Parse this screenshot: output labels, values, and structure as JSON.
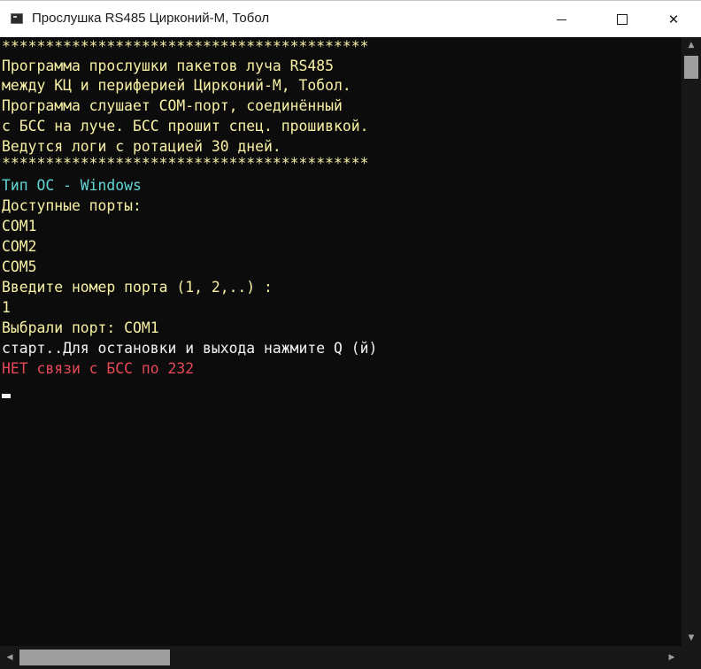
{
  "window": {
    "title": "Прослушка RS485 Цирконий-М, Тобол"
  },
  "titlebar": {
    "minimize_icon": "minimize-icon",
    "maximize_icon": "maximize-icon",
    "close_glyph": "✕"
  },
  "console": {
    "lines": [
      {
        "text": "******************************************",
        "color": "#f9f1a5"
      },
      {
        "text": "Программа прослушки пакетов луча RS485",
        "color": "#f9f1a5"
      },
      {
        "text": "между КЦ и периферией Цирконий-М, Тобол.",
        "color": "#f9f1a5"
      },
      {
        "text": "Программа слушает COM-порт, соединённый",
        "color": "#f9f1a5"
      },
      {
        "text": "с БСС на луче. БСС прошит спец. прошивкой.",
        "color": "#f9f1a5"
      },
      {
        "text": "Ведутся логи с ротацией 30 дней.",
        "color": "#f9f1a5"
      },
      {
        "text": "******************************************",
        "color": "#f9f1a5"
      },
      {
        "text": "Тип ОС - Windows",
        "color": "#61d6d6"
      },
      {
        "text": "Доступные порты:",
        "color": "#f9f1a5"
      },
      {
        "text": "COM1",
        "color": "#f9f1a5"
      },
      {
        "text": "COM2",
        "color": "#f9f1a5"
      },
      {
        "text": "COM5",
        "color": "#f9f1a5"
      },
      {
        "text": "Введите номер порта (1, 2,..) :",
        "color": "#f9f1a5"
      },
      {
        "text": "1",
        "color": "#f9f1a5"
      },
      {
        "text": "Выбрали порт: COM1",
        "color": "#f9f1a5"
      },
      {
        "text": "старт..Для остановки и выхода нажмите Q (й)",
        "color": "#f2f2f2"
      },
      {
        "text": "НЕТ связи с БСС по 232",
        "color": "#e74856"
      }
    ]
  },
  "scrollbars": {
    "up_arrow": "▲",
    "down_arrow": "▼",
    "left_arrow": "◀",
    "right_arrow": "▶"
  }
}
